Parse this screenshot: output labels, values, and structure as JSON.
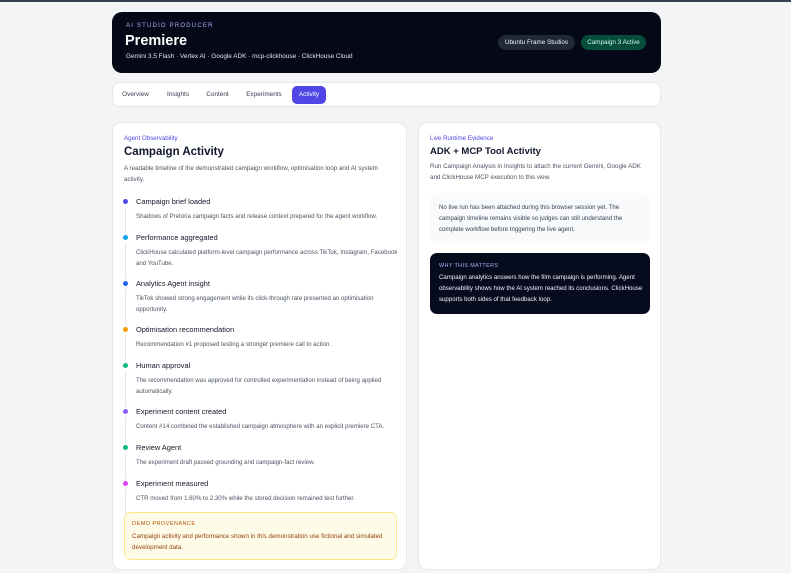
{
  "header": {
    "eyebrow": "AI STUDIO PRODUCER",
    "title": "Premiere",
    "subtitle": "Gemini 3.5 Flash · Vertex AI · Google ADK · mcp-clickhouse · ClickHouse Cloud",
    "studio_badge": "Ubuntu Frame Studios",
    "campaign_badge": "Campaign 3 Active"
  },
  "tabs": [
    "Overview",
    "Insights",
    "Content",
    "Experiments",
    "Activity"
  ],
  "active_tab": "Activity",
  "colors": {
    "header_bg": "#050817",
    "accent": "#4f46e5",
    "campaign_badge": "#064e3b"
  },
  "activity": {
    "kicker": "Agent Observability",
    "title": "Campaign Activity",
    "description": "A readable timeline of the demonstrated campaign workflow, optimisation loop and AI system activity.",
    "items": [
      {
        "title": "Campaign brief loaded",
        "desc": "Shadows of Pretoria campaign facts and release context prepared for the agent workflow.",
        "color": "#4f46e5"
      },
      {
        "title": "Performance aggregated",
        "desc": "ClickHouse calculated platform-level campaign performance across TikTok, Instagram, Facebook and YouTube.",
        "color": "#0ea5e9"
      },
      {
        "title": "Analytics Agent insight",
        "desc": "TikTok showed strong engagement while its click-through rate presented an optimisation opportunity.",
        "color": "#2563eb"
      },
      {
        "title": "Optimisation recommendation",
        "desc": "Recommendation #1 proposed testing a stronger premiere call to action.",
        "color": "#f59e0b"
      },
      {
        "title": "Human approval",
        "desc": "The recommendation was approved for controlled experimentation instead of being applied automatically.",
        "color": "#10b981"
      },
      {
        "title": "Experiment content created",
        "desc": "Content #14 combined the established campaign atmosphere with an explicit premiere CTA.",
        "color": "#8b5cf6"
      },
      {
        "title": "Review Agent",
        "desc": "The experiment draft passed grounding and campaign-fact review.",
        "color": "#10b981"
      },
      {
        "title": "Experiment measured",
        "desc": "CTR moved from 1.60% to 2.30% while the stored decision remained test further.",
        "color": "#d946ef"
      }
    ],
    "provenance_label": "DEMO PROVENANCE",
    "provenance_text": "Campaign activity and performance shown in this demonstration use fictional and simulated development data."
  },
  "runtime": {
    "kicker": "Live Runtime Evidence",
    "title": "ADK + MCP Tool Activity",
    "description": "Run Campaign Analysis in Insights to attach the current Gemini, Google ADK and ClickHouse MCP execution to this view.",
    "notice": "No live run has been attached during this browser session yet. The campaign timeline remains visible so judges can still understand the complete workflow before triggering the live agent.",
    "why_label": "WHY THIS MATTERS",
    "why_text": "Campaign analytics answers how the film campaign is performing. Agent observability shows how the AI system reached its conclusions. ClickHouse supports both sides of that feedback loop."
  }
}
